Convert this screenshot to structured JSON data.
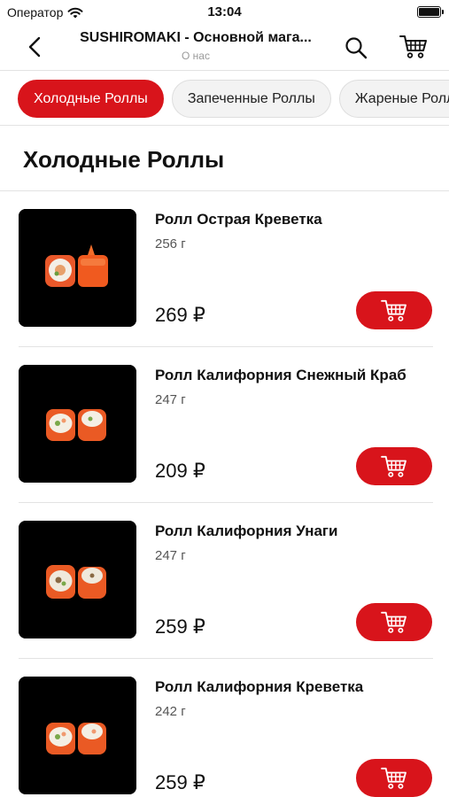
{
  "status_bar": {
    "carrier": "Оператор",
    "time": "13:04"
  },
  "nav": {
    "title": "SUSHIROMAKI - Основной мага...",
    "subtitle": "О нас",
    "back_icon": "chevron-left-icon",
    "search_icon": "search-icon",
    "cart_icon": "cart-icon"
  },
  "tabs": [
    {
      "label": "Холодные Роллы",
      "active": true
    },
    {
      "label": "Запеченные Роллы",
      "active": false
    },
    {
      "label": "Жареные Роллы",
      "active": false
    }
  ],
  "section": {
    "title": "Холодные Роллы"
  },
  "products": [
    {
      "name": "Ролл Острая Креветка",
      "weight": "256 г",
      "price": "269 ₽"
    },
    {
      "name": "Ролл Калифорния Снежный Краб",
      "weight": "247 г",
      "price": "209 ₽"
    },
    {
      "name": "Ролл Калифорния Унаги",
      "weight": "247 г",
      "price": "259 ₽"
    },
    {
      "name": "Ролл Калифорния Креветка",
      "weight": "242 г",
      "price": "259 ₽"
    }
  ],
  "colors": {
    "accent": "#d8141b",
    "divider": "#e3e3e3",
    "tab_inactive_bg": "#f3f3f3"
  }
}
